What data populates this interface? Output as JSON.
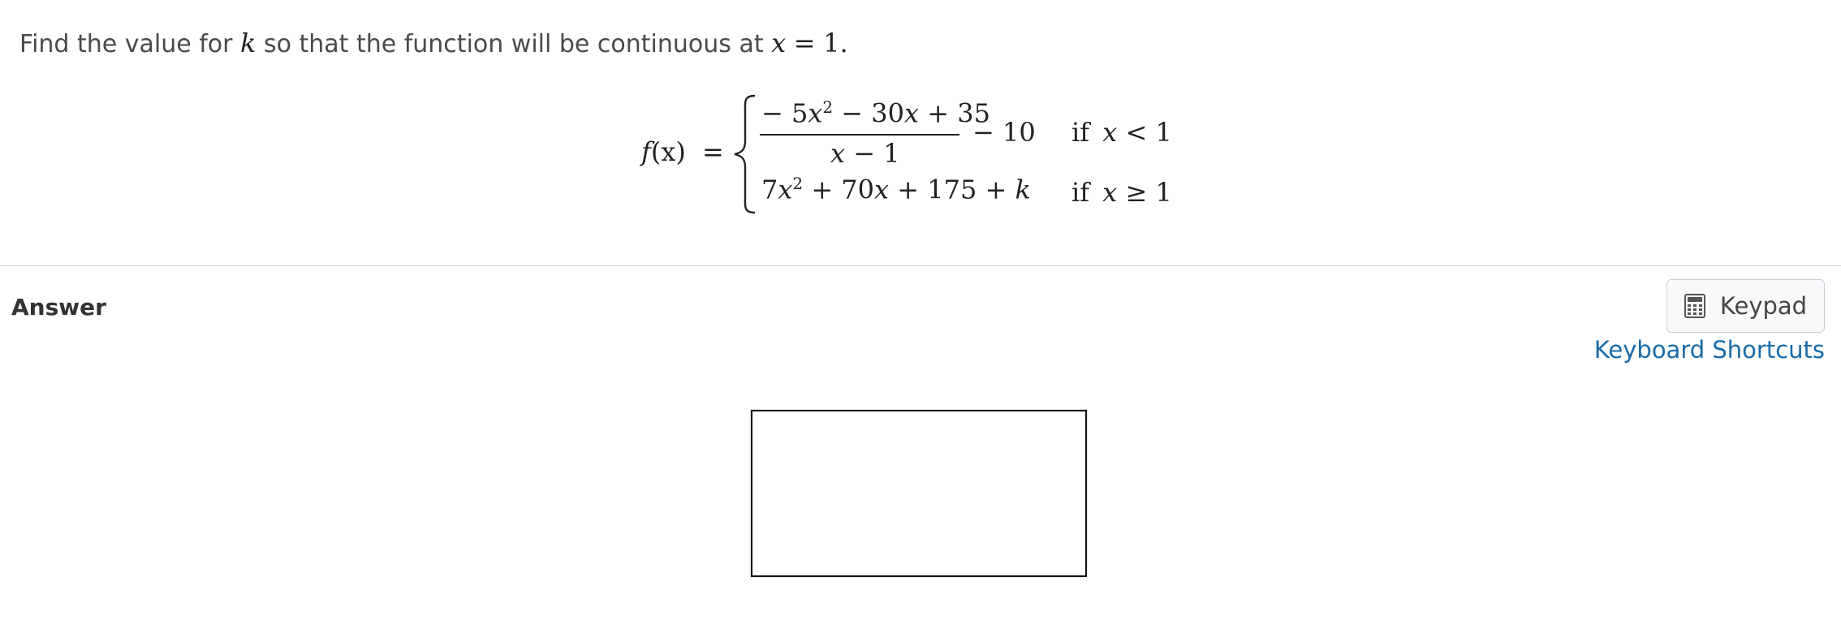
{
  "question": {
    "text_before_k": "Find the value for ",
    "k": "k",
    "text_after_k": " so that the function will be continuous at ",
    "x": "x",
    "equals": "=",
    "value": "1",
    "period": "."
  },
  "equation": {
    "f": "f",
    "lhs_paren": "(x)",
    "equals": "=",
    "case1": {
      "numerator_prefix": "− 5",
      "numerator_x1": "x",
      "numerator_exp": "2",
      "numerator_rest1": " − 30",
      "numerator_x2": "x",
      "numerator_rest2": " + 35",
      "denominator_x": "x",
      "denominator_rest": " − 1",
      "tail": "− 10",
      "condition_if": "if",
      "condition_x": "x",
      "condition_rest": " < 1"
    },
    "case2": {
      "prefix": "7",
      "x1": "x",
      "exp": "2",
      "mid": " + 70",
      "x2": "x",
      "rest": " + 175 + ",
      "k": "k",
      "condition_if": "if",
      "condition_x": "x",
      "condition_rest": " ≥ 1"
    }
  },
  "answer": {
    "label": "Answer",
    "input_value": ""
  },
  "toolbar": {
    "keypad_label": "Keypad",
    "shortcuts_label": "Keyboard Shortcuts"
  },
  "icons": {
    "keypad": "calculator-icon"
  }
}
